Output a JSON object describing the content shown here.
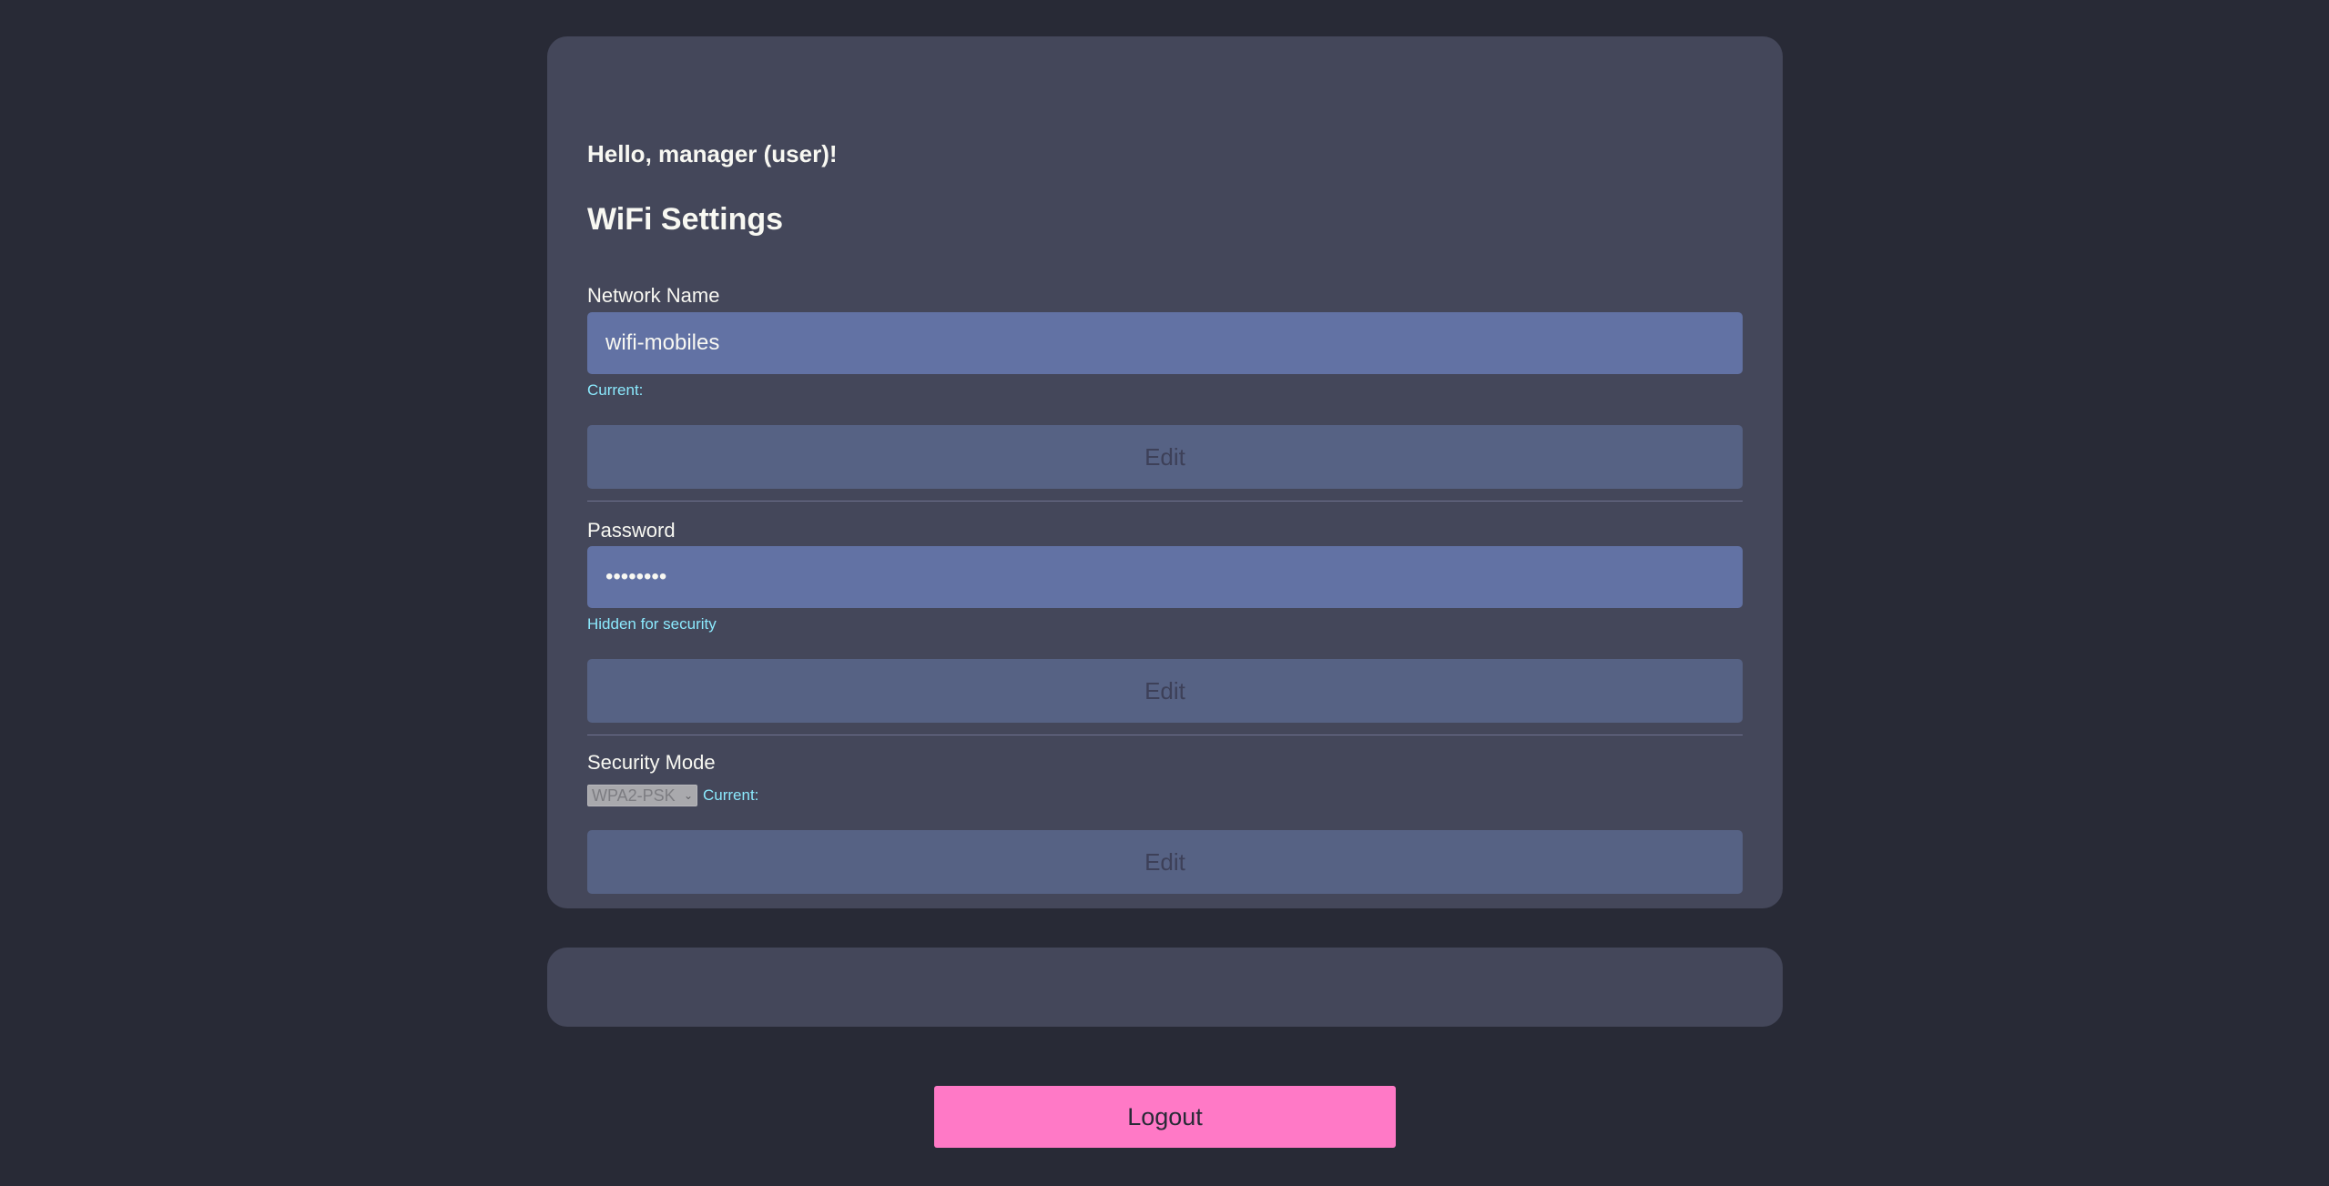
{
  "greeting": "Hello, manager (user)!",
  "title": "WiFi Settings",
  "network": {
    "label": "Network Name",
    "value": "wifi-mobiles",
    "hint": "Current:",
    "edit_label": "Edit"
  },
  "password": {
    "label": "Password",
    "value": "••••••••",
    "hint": "Hidden for security",
    "edit_label": "Edit"
  },
  "security": {
    "label": "Security Mode",
    "selected": "WPA2-PSK",
    "hint": "Current:",
    "edit_label": "Edit"
  },
  "logout_label": "Logout",
  "colors": {
    "background": "#282a36",
    "card": "#44475a",
    "input": "#6272a4",
    "hint": "#8be9fd",
    "logout": "#ff79c6"
  }
}
